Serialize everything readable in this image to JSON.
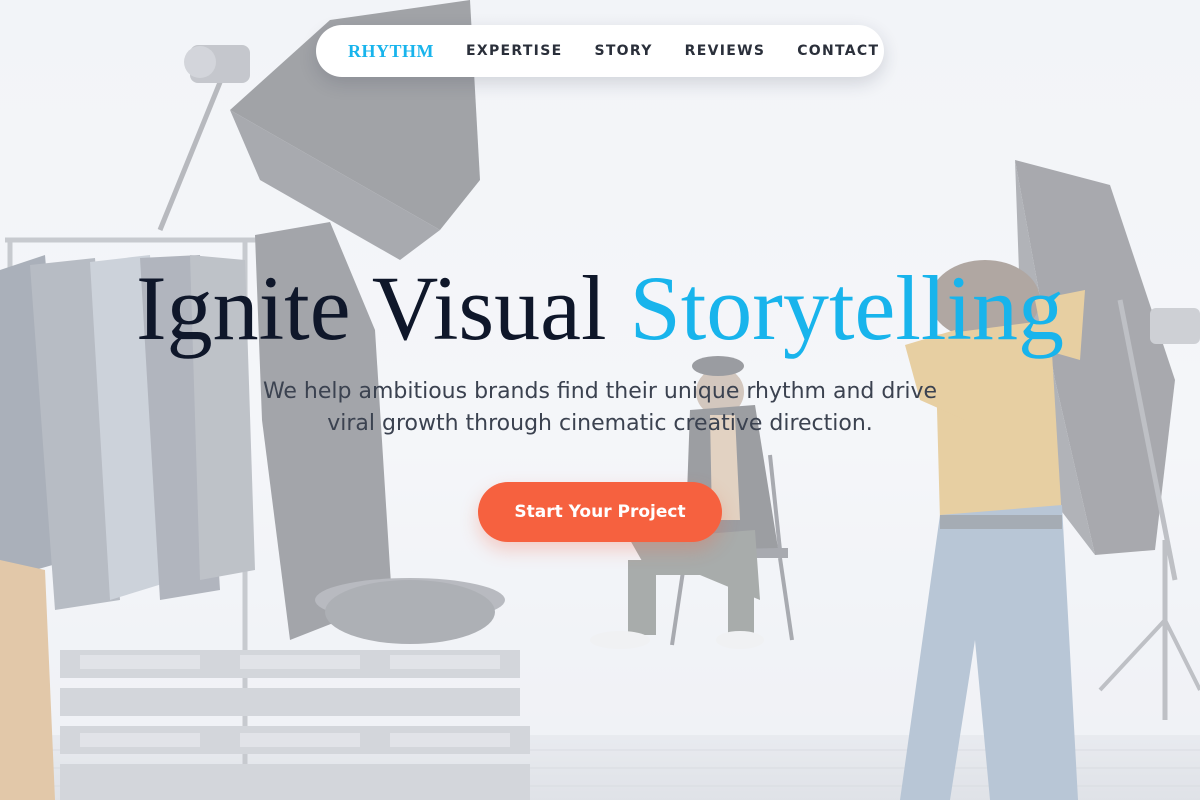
{
  "nav": {
    "brand": "RHYTHM",
    "links": [
      "EXPERTISE",
      "STORY",
      "REVIEWS",
      "CONTACT"
    ]
  },
  "hero": {
    "headline_main": "Ignite Visual",
    "headline_accent": "Storytelling",
    "subtitle": "We help ambitious brands find their unique rhythm and drive viral growth through cinematic creative direction.",
    "cta_label": "Start Your Project",
    "background_image": "photo-studio-scene"
  },
  "colors": {
    "accent": "#18b4ec",
    "cta": "#f6613f",
    "headline": "#0f172a",
    "nav_text": "#2a2f3a"
  }
}
